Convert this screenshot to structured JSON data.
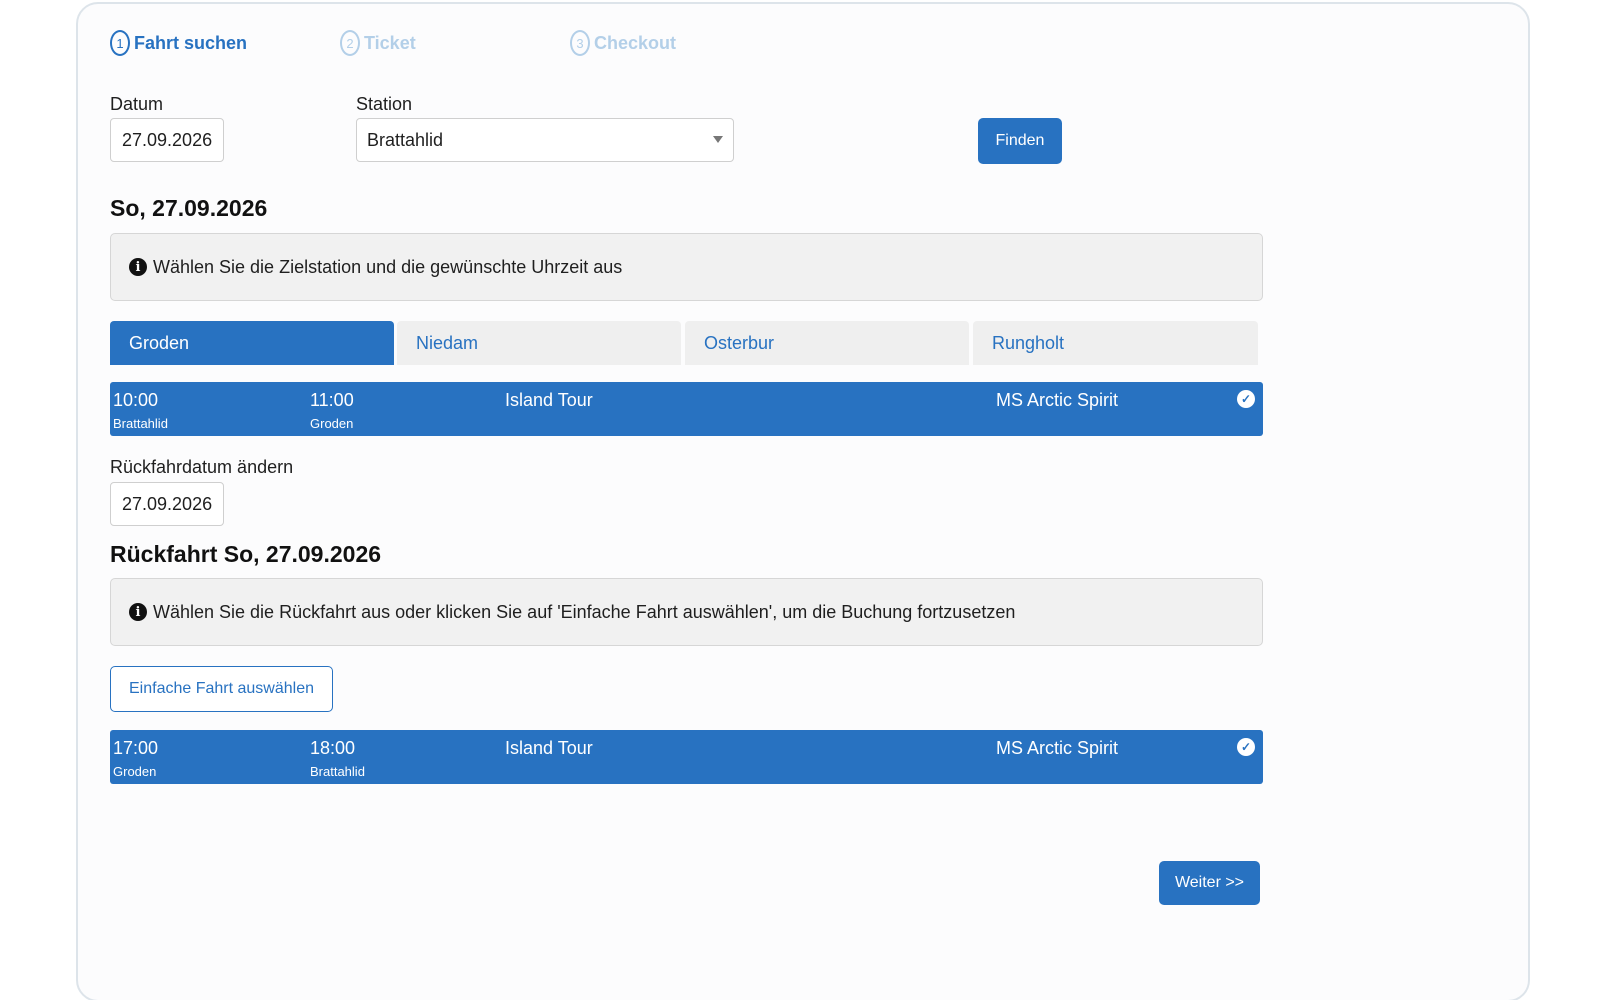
{
  "steps": [
    {
      "num": "1",
      "label": "Fahrt suchen"
    },
    {
      "num": "2",
      "label": "Ticket"
    },
    {
      "num": "3",
      "label": "Checkout"
    }
  ],
  "search": {
    "date_label": "Datum",
    "date_value": "27.09.2026",
    "station_label": "Station",
    "station_value": "Brattahlid",
    "find_button": "Finden"
  },
  "outbound": {
    "heading": "So, 27.09.2026",
    "info": "Wählen Sie die Zielstation und die gewünschte Uhrzeit aus",
    "tabs": [
      "Groden",
      "Niedam",
      "Osterbur",
      "Rungholt"
    ],
    "trip": {
      "dep_time": "10:00",
      "dep_station": "Brattahlid",
      "arr_time": "11:00",
      "arr_station": "Groden",
      "tour": "Island Tour",
      "ship": "MS Arctic Spirit"
    }
  },
  "return": {
    "change_date_label": "Rückfahrdatum ändern",
    "date_value": "27.09.2026",
    "heading": "Rückfahrt So, 27.09.2026",
    "info": "Wählen Sie die Rückfahrt aus oder klicken Sie auf 'Einfache Fahrt auswählen', um die Buchung fortzusetzen",
    "single_trip_button": "Einfache Fahrt auswählen",
    "trip": {
      "dep_time": "17:00",
      "dep_station": "Groden",
      "arr_time": "18:00",
      "arr_station": "Brattahlid",
      "tour": "Island Tour",
      "ship": "MS Arctic Spirit"
    }
  },
  "next_button": "Weiter >>",
  "colors": {
    "accent": "#2872c1",
    "inactive_step": "#b3cfe8",
    "info_bg": "#f1f1f1"
  }
}
